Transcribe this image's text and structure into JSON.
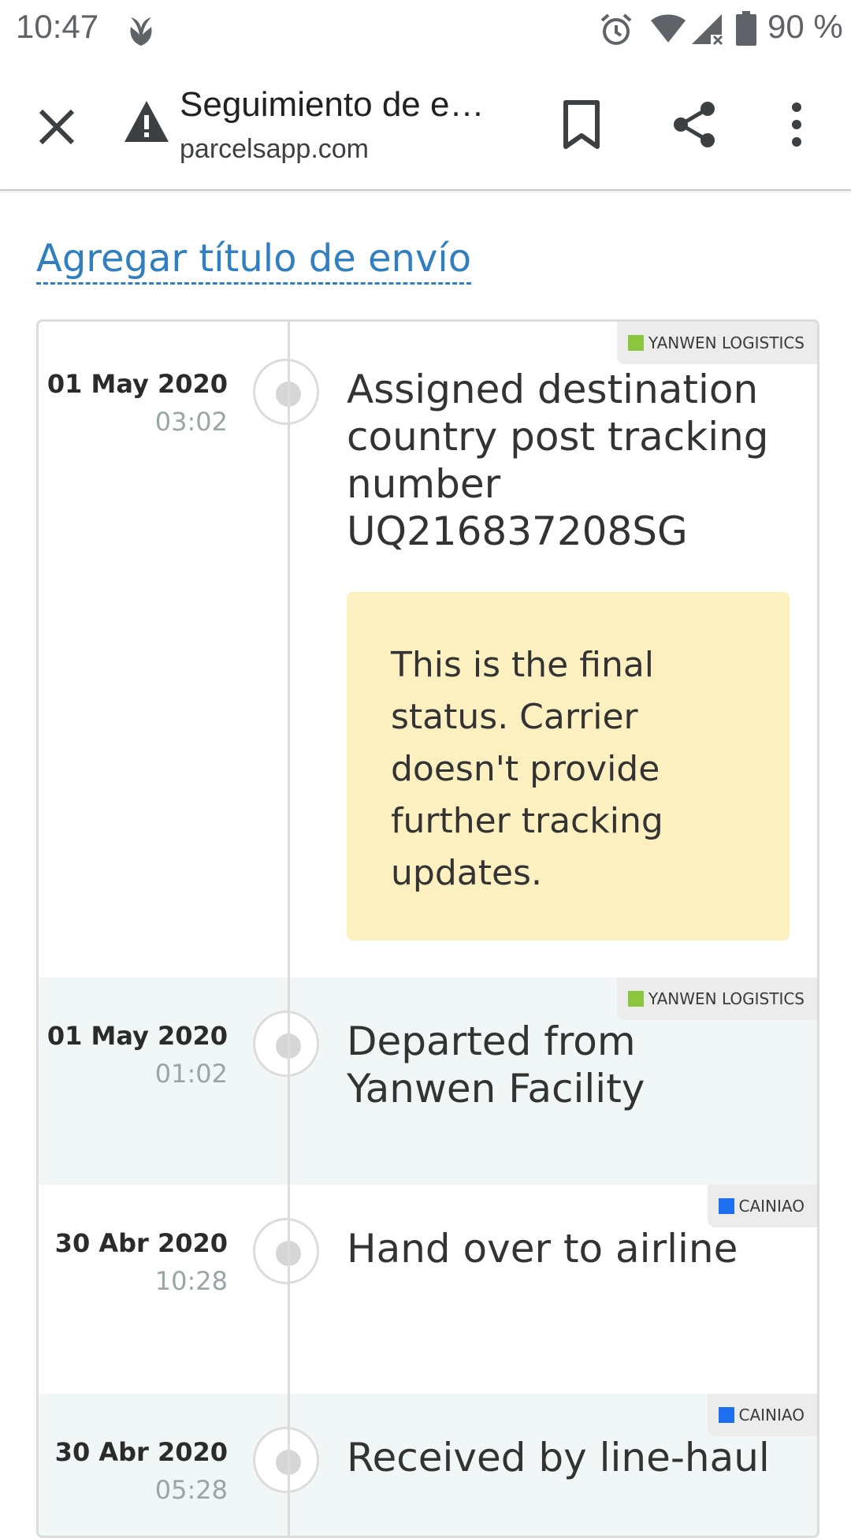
{
  "status_bar": {
    "time": "10:47",
    "battery_percent": "90 %",
    "icons": [
      "app-notification-icon",
      "alarm-icon",
      "wifi-icon",
      "signal-icon",
      "battery-icon"
    ]
  },
  "toolbar": {
    "title": "Seguimiento de e…",
    "url": "parcelsapp.com",
    "icons": [
      "close-icon",
      "warning-icon",
      "bookmark-icon",
      "share-icon",
      "more-vert-icon"
    ]
  },
  "page": {
    "add_title_link": "Agregar título de envío"
  },
  "events": [
    {
      "carrier": "YANWEN LOGISTICS",
      "date": "01 May 2020",
      "time": "03:02",
      "status": "Assigned destination country post tracking number UQ216837208SG",
      "note": "This is the final status. Carrier doesn't provide further tracking updates."
    },
    {
      "carrier": "YANWEN LOGISTICS",
      "date": "01 May 2020",
      "time": "01:02",
      "status": "Departed from Yanwen Facility"
    },
    {
      "carrier": "CAINIAO",
      "date": "30 Abr 2020",
      "time": "10:28",
      "status": "Hand over to airline"
    },
    {
      "carrier": "CAINIAO",
      "date": "30 Abr 2020",
      "time": "05:28",
      "status": "Received by line-haul"
    }
  ],
  "colors": {
    "link": "#2f7fc1",
    "note_background": "#fdf0c0",
    "alt_row_background": "#f1f6f7",
    "yanwen_logo": "#8cc63f",
    "cainiao_logo": "#1e6ff0"
  }
}
